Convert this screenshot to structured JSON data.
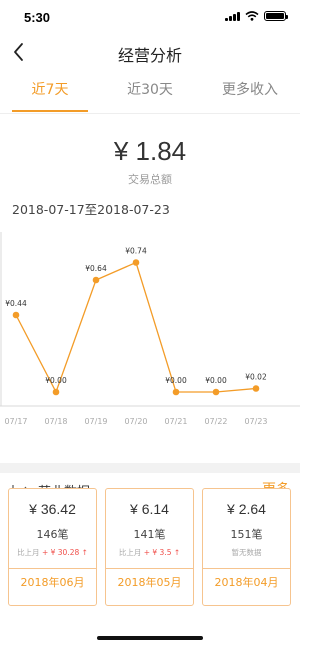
{
  "status_bar": {
    "time": "5:30"
  },
  "nav": {
    "title": "经营分析"
  },
  "tabs": [
    {
      "label": "近7天",
      "active": true
    },
    {
      "label": "近30天",
      "active": false
    },
    {
      "label": "更多收入",
      "active": false
    }
  ],
  "summary": {
    "total_amount": "¥ 1.84",
    "total_label": "交易总额",
    "date_range": "2018-07-17至2018-07-23"
  },
  "chart_data": {
    "type": "line",
    "categories": [
      "07/17",
      "07/18",
      "07/19",
      "07/20",
      "07/21",
      "07/22",
      "07/23"
    ],
    "values": [
      0.44,
      0.0,
      0.64,
      0.74,
      0.0,
      0.0,
      0.02
    ],
    "data_labels": [
      "¥0.44",
      "¥0.00",
      "¥0.64",
      "¥0.74",
      "¥0.00",
      "¥0.00",
      "¥0.02"
    ],
    "ylim": [
      0,
      0.8
    ],
    "color": "#f39c28"
  },
  "business": {
    "title": "营业数据",
    "more_label": "更多",
    "cards": [
      {
        "amount": "¥ 36.42",
        "count": "146笔",
        "compare_prefix": "比上月",
        "compare_value": "+ ¥ 30.28 ↑",
        "month": "2018年06月"
      },
      {
        "amount": "¥ 6.14",
        "count": "141笔",
        "compare_prefix": "比上月",
        "compare_value": "+ ¥ 3.5 ↑",
        "month": "2018年05月"
      },
      {
        "amount": "¥ 2.64",
        "count": "151笔",
        "compare_prefix": "暂无数据",
        "compare_value": "",
        "month": "2018年04月"
      }
    ]
  },
  "colors": {
    "accent": "#f39c28",
    "up": "#f0504b"
  }
}
